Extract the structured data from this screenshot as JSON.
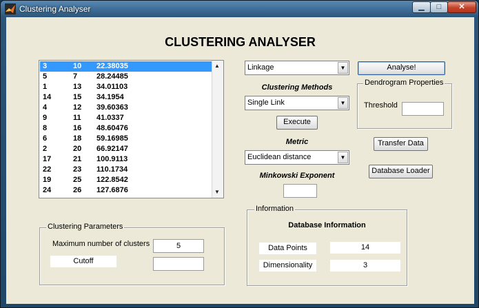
{
  "window": {
    "title": "Clustering Analyser"
  },
  "title_buttons": {
    "minimize": "▁",
    "maximize": "□",
    "close": "✕"
  },
  "heading": "CLUSTERING ANALYSER",
  "list": {
    "rows": [
      [
        "3",
        "10",
        "22.38035"
      ],
      [
        "5",
        "7",
        "28.24485"
      ],
      [
        "1",
        "13",
        "34.01103"
      ],
      [
        "14",
        "15",
        "34.1954"
      ],
      [
        "4",
        "12",
        "39.60363"
      ],
      [
        "9",
        "11",
        "41.0337"
      ],
      [
        "8",
        "16",
        "48.60476"
      ],
      [
        "6",
        "18",
        "59.16985"
      ],
      [
        "2",
        "20",
        "66.92147"
      ],
      [
        "17",
        "21",
        "100.9113"
      ],
      [
        "22",
        "23",
        "110.1734"
      ],
      [
        "19",
        "25",
        "122.8542"
      ],
      [
        "24",
        "26",
        "127.6876"
      ]
    ],
    "selected_index": 0,
    "scroll_up": "▲",
    "scroll_down": "▼"
  },
  "method_type": {
    "value": "Linkage",
    "arrow": "▼"
  },
  "clustering_methods": {
    "label": "Clustering Methods",
    "value": "Single Link",
    "arrow": "▼"
  },
  "execute_label": "Execute",
  "metric": {
    "label": "Metric",
    "value": "Euclidean distance",
    "arrow": "▼"
  },
  "minkowski": {
    "label": "Minkowski Exponent",
    "value": ""
  },
  "analyse_label": "Analyse!",
  "dendrogram": {
    "title": "Dendrogram Properties",
    "threshold_label": "Threshold",
    "threshold_value": ""
  },
  "transfer_label": "Transfer Data",
  "database_loader_label": "Database Loader",
  "clustering_parameters": {
    "title": "Clustering Parameters",
    "max_clusters_label": "Maximum number of clusters",
    "max_clusters_value": "5",
    "cutoff_label": "Cutoff",
    "cutoff_value": ""
  },
  "information": {
    "title": "Information",
    "heading": "Database Information",
    "data_points_label": "Data Points",
    "data_points_value": "14",
    "dimensionality_label": "Dimensionality",
    "dimensionality_value": "3"
  }
}
